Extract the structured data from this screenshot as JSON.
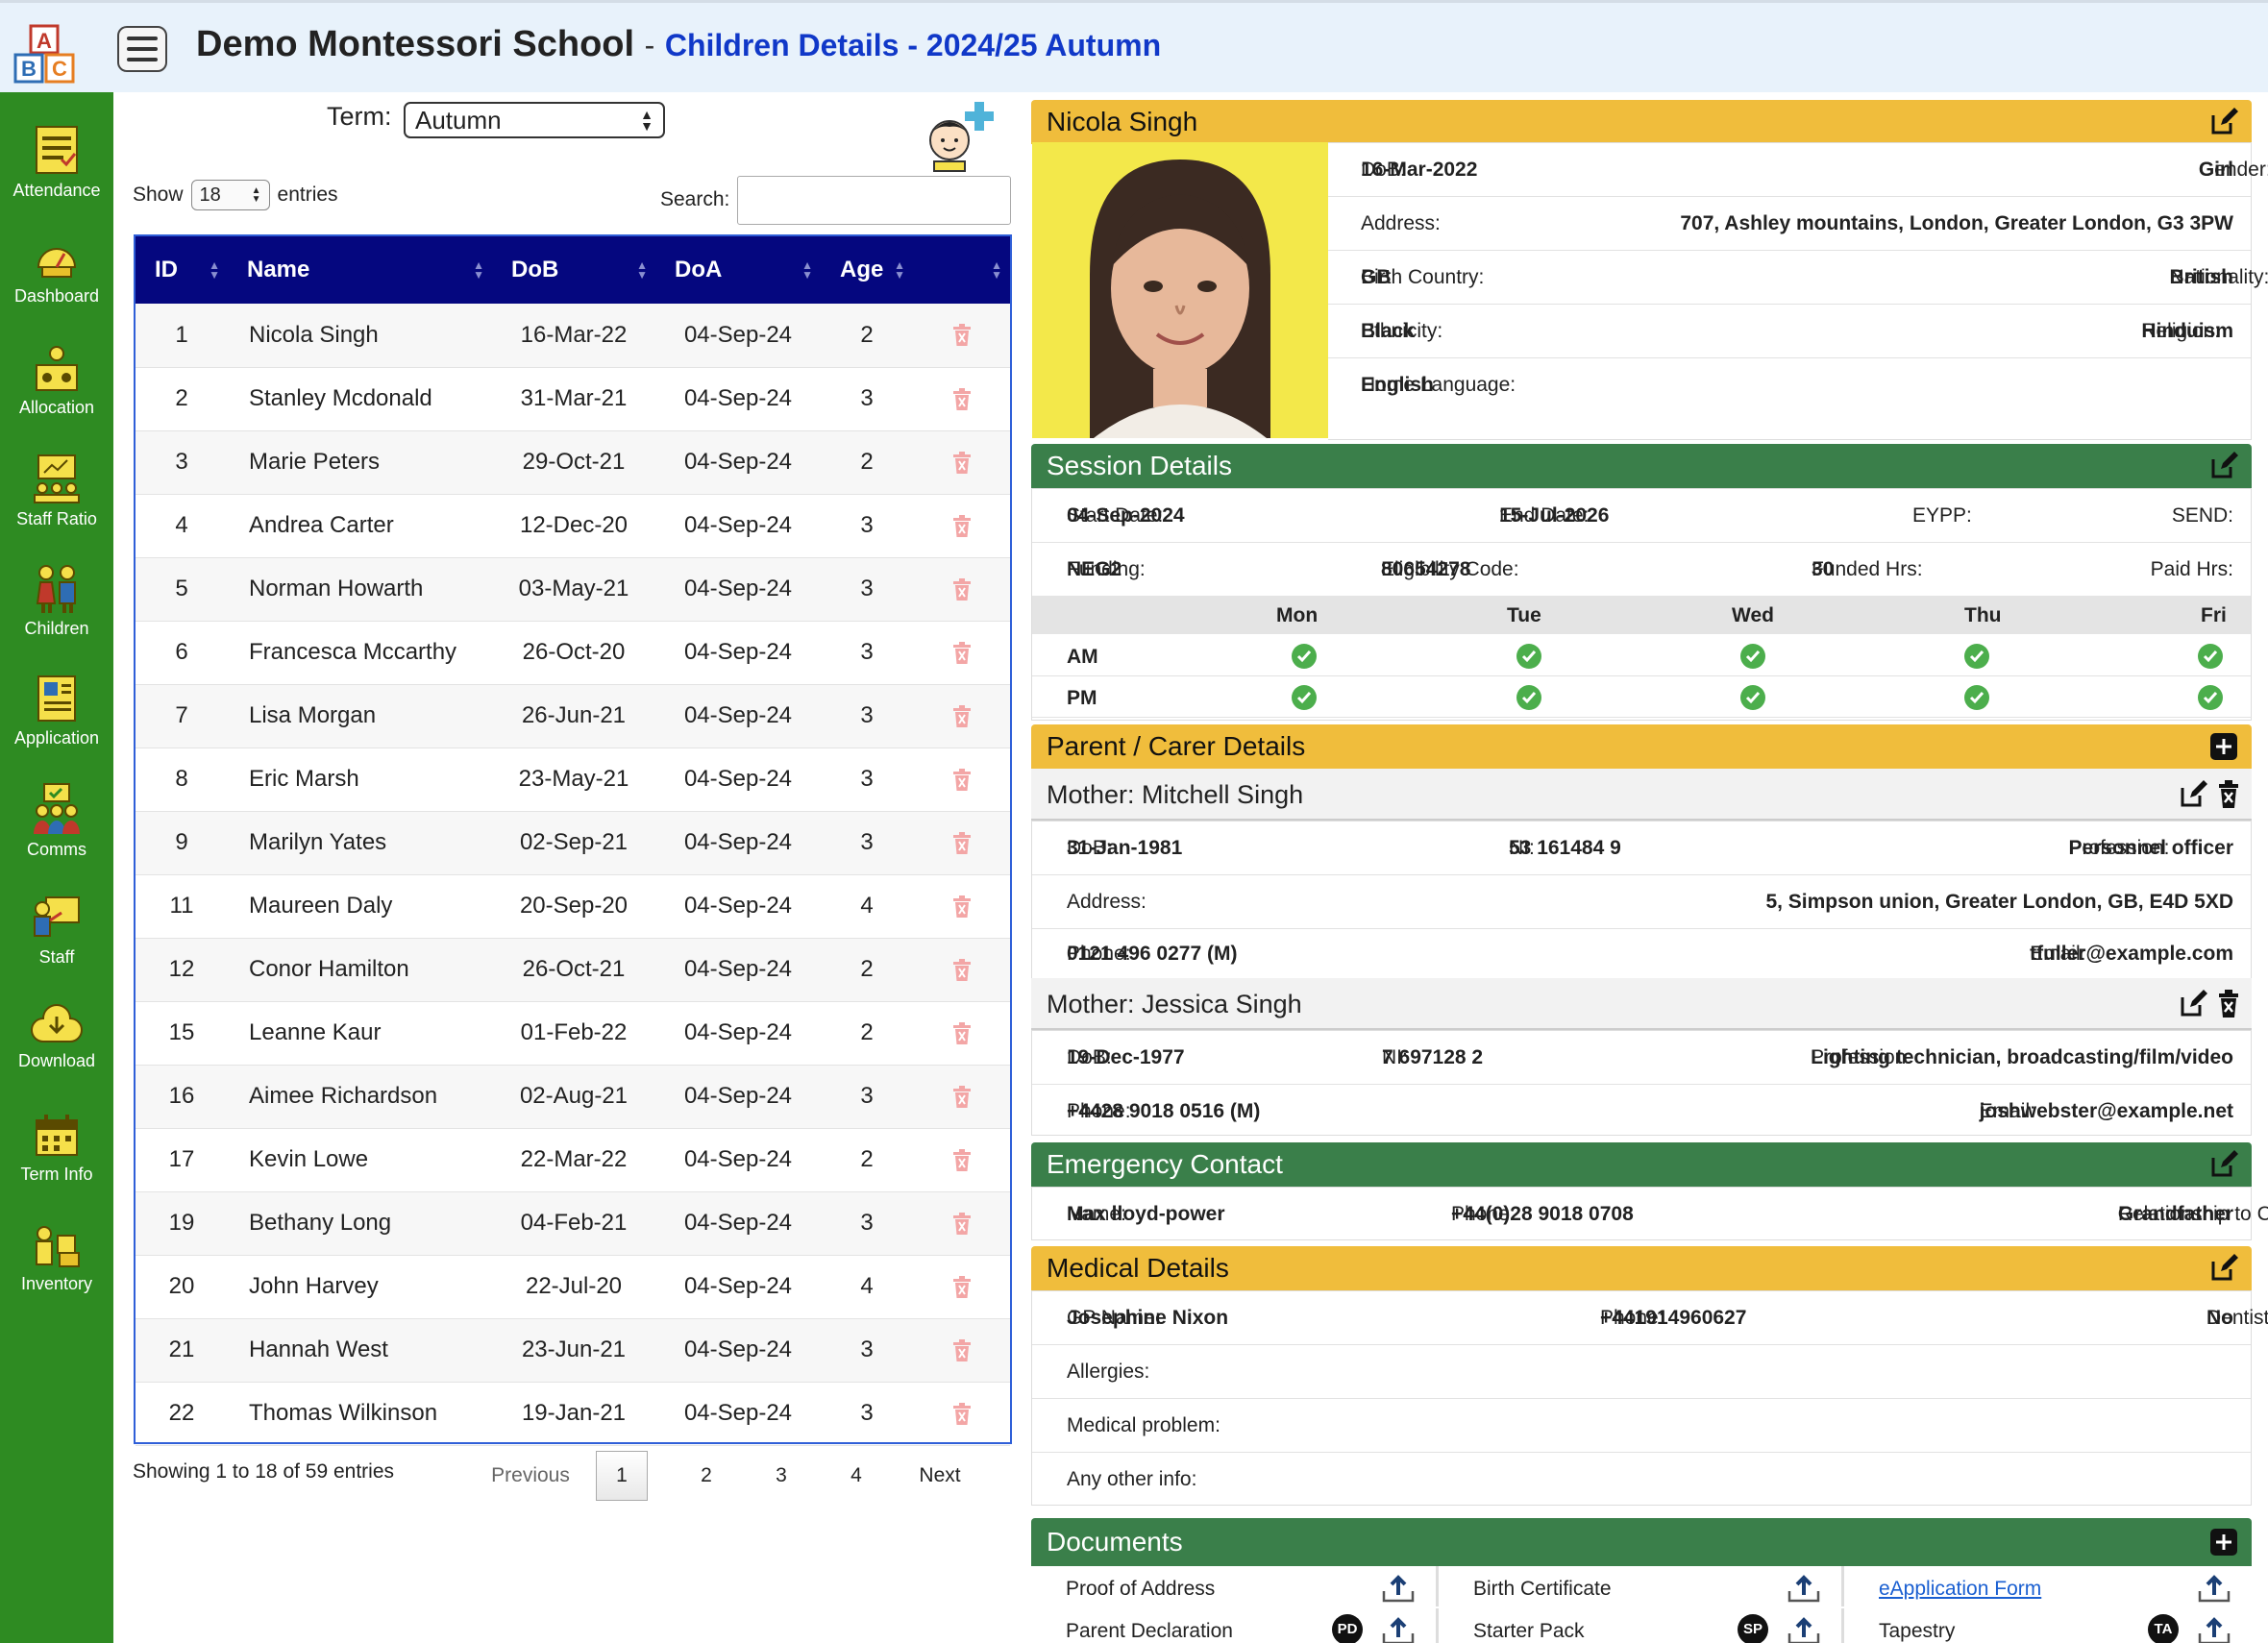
{
  "header": {
    "school": "Demo Montessori School",
    "separator": "-",
    "subtitle": "Children Details - 2024/25 Autumn"
  },
  "sidebar": {
    "items": [
      {
        "label": "Attendance",
        "icon": "attendance-icon"
      },
      {
        "label": "Dashboard",
        "icon": "dashboard-icon"
      },
      {
        "label": "Allocation",
        "icon": "allocation-icon"
      },
      {
        "label": "Staff Ratio",
        "icon": "staff-ratio-icon"
      },
      {
        "label": "Children",
        "icon": "children-icon"
      },
      {
        "label": "Application",
        "icon": "application-icon"
      },
      {
        "label": "Comms",
        "icon": "comms-icon"
      },
      {
        "label": "Staff",
        "icon": "staff-icon"
      },
      {
        "label": "Download",
        "icon": "download-icon"
      },
      {
        "label": "Term Info",
        "icon": "term-info-icon"
      },
      {
        "label": "Inventory",
        "icon": "inventory-icon"
      }
    ]
  },
  "filters": {
    "term_label": "Term:",
    "term_value": "Autumn",
    "show_label": "Show",
    "show_value": "18",
    "entries_label": "entries",
    "search_label": "Search:",
    "search_value": ""
  },
  "table": {
    "headers": [
      "ID",
      "Name",
      "DoB",
      "DoA",
      "Age"
    ],
    "rows": [
      [
        "1",
        "Nicola Singh",
        "16-Mar-22",
        "04-Sep-24",
        "2"
      ],
      [
        "2",
        "Stanley Mcdonald",
        "31-Mar-21",
        "04-Sep-24",
        "3"
      ],
      [
        "3",
        "Marie Peters",
        "29-Oct-21",
        "04-Sep-24",
        "2"
      ],
      [
        "4",
        "Andrea Carter",
        "12-Dec-20",
        "04-Sep-24",
        "3"
      ],
      [
        "5",
        "Norman Howarth",
        "03-May-21",
        "04-Sep-24",
        "3"
      ],
      [
        "6",
        "Francesca Mccarthy",
        "26-Oct-20",
        "04-Sep-24",
        "3"
      ],
      [
        "7",
        "Lisa Morgan",
        "26-Jun-21",
        "04-Sep-24",
        "3"
      ],
      [
        "8",
        "Eric Marsh",
        "23-May-21",
        "04-Sep-24",
        "3"
      ],
      [
        "9",
        "Marilyn Yates",
        "02-Sep-21",
        "04-Sep-24",
        "3"
      ],
      [
        "11",
        "Maureen Daly",
        "20-Sep-20",
        "04-Sep-24",
        "4"
      ],
      [
        "12",
        "Conor Hamilton",
        "26-Oct-21",
        "04-Sep-24",
        "2"
      ],
      [
        "15",
        "Leanne Kaur",
        "01-Feb-22",
        "04-Sep-24",
        "2"
      ],
      [
        "16",
        "Aimee Richardson",
        "02-Aug-21",
        "04-Sep-24",
        "3"
      ],
      [
        "17",
        "Kevin Lowe",
        "22-Mar-22",
        "04-Sep-24",
        "2"
      ],
      [
        "19",
        "Bethany Long",
        "04-Feb-21",
        "04-Sep-24",
        "3"
      ],
      [
        "20",
        "John Harvey",
        "22-Jul-20",
        "04-Sep-24",
        "4"
      ],
      [
        "21",
        "Hannah West",
        "23-Jun-21",
        "04-Sep-24",
        "3"
      ],
      [
        "22",
        "Thomas Wilkinson",
        "19-Jan-21",
        "04-Sep-24",
        "3"
      ]
    ],
    "showing": "Showing 1 to 18 of 59 entries",
    "pager": {
      "previous": "Previous",
      "pages": [
        "1",
        "2",
        "3",
        "4"
      ],
      "next": "Next"
    }
  },
  "child": {
    "name": "Nicola Singh",
    "dob_label": "DoB:",
    "dob": "16-Mar-2022",
    "gender_label": "Gender:",
    "gender": "Girl",
    "address_label": "Address:",
    "address": "707, Ashley mountains, London, Greater London, G3 3PW",
    "birth_country_label": "Birth Country:",
    "birth_country": "GB",
    "nationality_label": "Nationality:",
    "nationality": "British",
    "ethnicity_label": "Ethnicity:",
    "ethnicity": "Black",
    "religion_label": "Religion:",
    "religion": "Hinduism",
    "home_language_label": "Home Language:",
    "home_language": "English"
  },
  "session": {
    "title": "Session Details",
    "start_label": "Start Date:",
    "start": "04-Sep-2024",
    "end_label": "End Date:",
    "end": "15-Jul-2026",
    "eypp_label": "EYPP:",
    "send_label": "SEND:",
    "funding_label": "Funding:",
    "funding": "NEG2",
    "elig_label": "Eligibility Code:",
    "elig": "80654278",
    "funded_label": "Funded Hrs:",
    "funded": "30",
    "paid_label": "Paid Hrs:",
    "days": [
      "Mon",
      "Tue",
      "Wed",
      "Thu",
      "Fri"
    ],
    "am_label": "AM",
    "pm_label": "PM"
  },
  "parents": {
    "title": "Parent / Carer Details",
    "p1": {
      "heading": "Mother: Mitchell Singh",
      "dob_label": "DoB:",
      "dob": "31-Jan-1981",
      "ni_label": "NI:",
      "ni": "53 161484 9",
      "prof_label": "Profession:",
      "prof": "Personnel officer",
      "address_label": "Address:",
      "address": "5, Simpson union, Greater London, GB, E4D 5XD",
      "phone_label": "Phone:",
      "phone": "0121 496 0277 (M)",
      "email_label": "Email:",
      "email": "tfuller@example.com"
    },
    "p2": {
      "heading": "Mother: Jessica Singh",
      "dob_label": "DoB:",
      "dob": "19-Dec-1977",
      "ni_label": "NI:",
      "ni": "7 697128 2",
      "prof_label": "Profession:",
      "prof": "Lighting technician, broadcasting/film/video",
      "phone_label": "Phone:",
      "phone": "+4428 9018 0516 (M)",
      "email_label": "Email:",
      "email": "joshwebster@example.net"
    }
  },
  "emergency": {
    "title": "Emergency Contact",
    "name_label": "Name:",
    "name": "Max lloyd-power",
    "phone_label": "Phone:",
    "phone": "+44(0)28 9018 0708",
    "rel_label": "Relationship to Child:",
    "rel": "Grandfather"
  },
  "medical": {
    "title": "Medical Details",
    "gp_label": "GP Name:",
    "gp": "Josephine Nixon",
    "phone_label": "Phone:",
    "phone": "+441914960627",
    "dentist_label": "Dentist:",
    "dentist": "No",
    "allergies_label": "Allergies:",
    "problem_label": "Medical problem:",
    "other_label": "Any other info:"
  },
  "documents": {
    "title": "Documents",
    "row1": [
      "Proof of Address",
      "Birth Certificate",
      "eApplication Form"
    ],
    "row2": [
      "Parent Declaration",
      "Starter Pack",
      "Tapestry"
    ],
    "badges": [
      "PD",
      "SP",
      "TA"
    ]
  },
  "colors": {
    "sidebar": "#2e8b22",
    "table_header": "#05077f",
    "section_yellow": "#f0bd3c",
    "section_green": "#3a7f4a",
    "subtitle_blue": "#1038c8"
  }
}
